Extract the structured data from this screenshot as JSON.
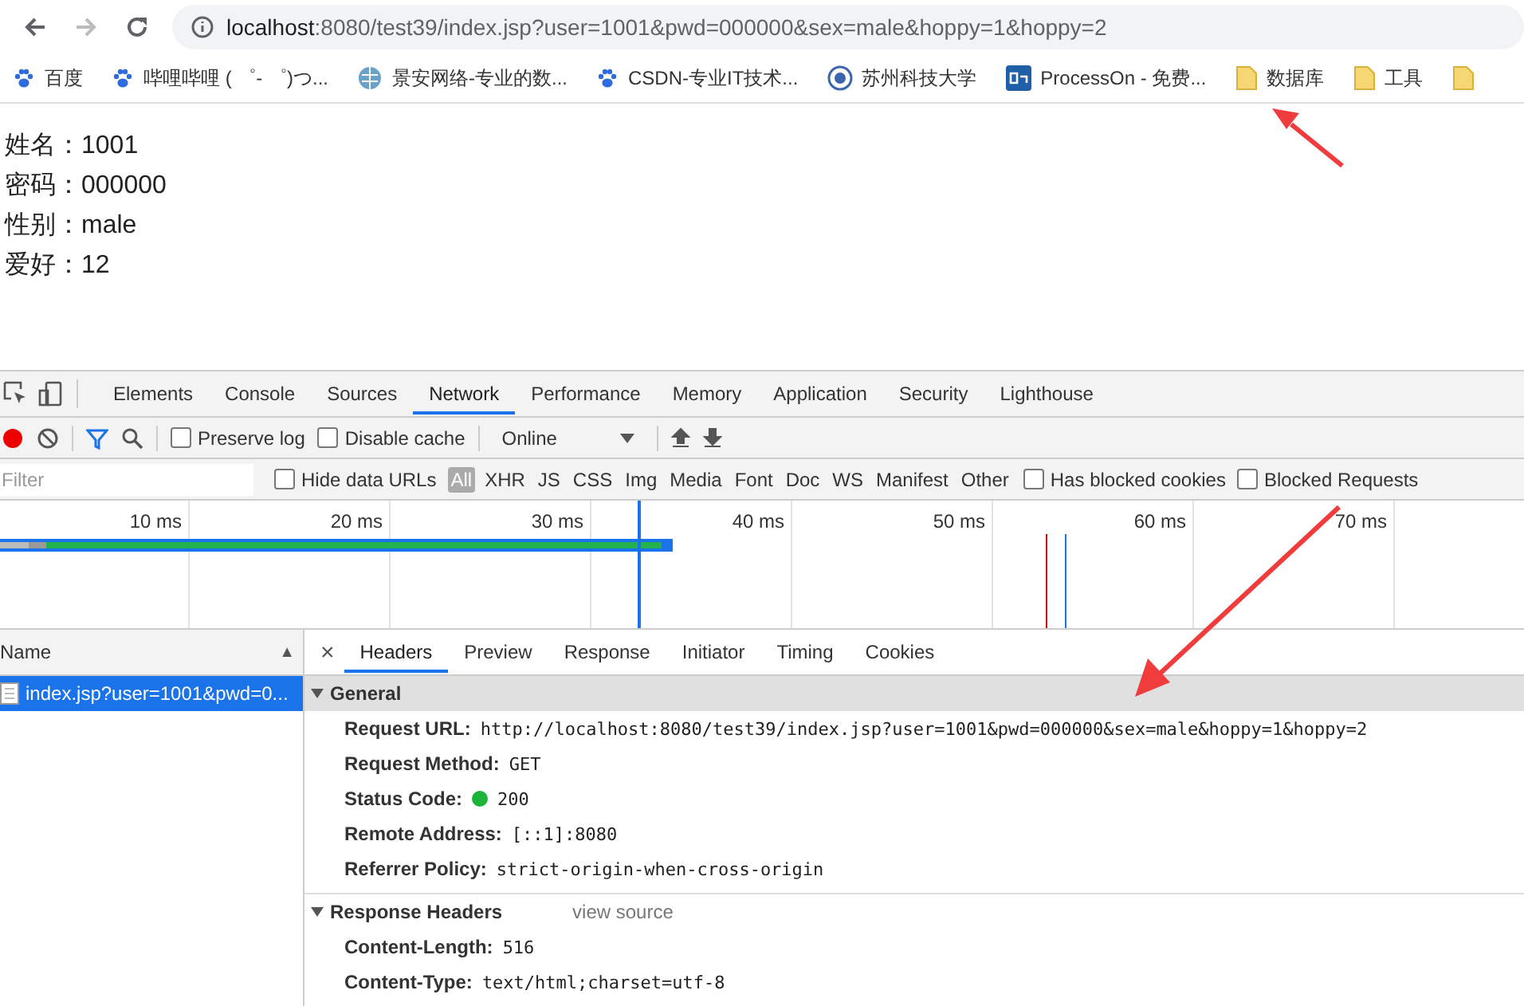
{
  "browser": {
    "url_host": "localhost",
    "url_rest": ":8080/test39/index.jsp?user=1001&pwd=000000&sex=male&hoppy=1&hoppy=2",
    "bookmarks": [
      {
        "label": "百度",
        "kind": "paw"
      },
      {
        "label": "哔哩哔哩 ( ゜- ゜)つ...",
        "kind": "paw"
      },
      {
        "label": "景安网络-专业的数...",
        "kind": "globe"
      },
      {
        "label": "CSDN-专业IT技术...",
        "kind": "paw"
      },
      {
        "label": "苏州科技大学",
        "kind": "seal"
      },
      {
        "label": "ProcessOn - 免费...",
        "kind": "on"
      },
      {
        "label": "数据库",
        "kind": "folder"
      },
      {
        "label": "工具",
        "kind": "folder"
      },
      {
        "kind": "folder"
      }
    ]
  },
  "page": {
    "lines": [
      {
        "label": "姓名：",
        "value": "1001"
      },
      {
        "label": "密码：",
        "value": "000000"
      },
      {
        "label": "性别：",
        "value": "male"
      },
      {
        "label": "爱好：",
        "value": "12"
      }
    ]
  },
  "devtools": {
    "tabs": [
      {
        "label": "Elements",
        "selected": false
      },
      {
        "label": "Console",
        "selected": false
      },
      {
        "label": "Sources",
        "selected": false
      },
      {
        "label": "Network",
        "selected": true
      },
      {
        "label": "Performance",
        "selected": false
      },
      {
        "label": "Memory",
        "selected": false
      },
      {
        "label": "Application",
        "selected": false
      },
      {
        "label": "Security",
        "selected": false
      },
      {
        "label": "Lighthouse",
        "selected": false
      }
    ],
    "toolbar": {
      "recording": true,
      "preserve_log": {
        "label": "Preserve log",
        "checked": false
      },
      "disable_cache": {
        "label": "Disable cache",
        "checked": false
      },
      "throttle": "Online"
    },
    "filter": {
      "placeholder": "Filter",
      "hide_data_urls": {
        "label": "Hide data URLs",
        "checked": false
      },
      "types": [
        {
          "label": "All",
          "selected": true
        },
        {
          "label": "XHR",
          "selected": false
        },
        {
          "label": "JS",
          "selected": false
        },
        {
          "label": "CSS",
          "selected": false
        },
        {
          "label": "Img",
          "selected": false
        },
        {
          "label": "Media",
          "selected": false
        },
        {
          "label": "Font",
          "selected": false
        },
        {
          "label": "Doc",
          "selected": false
        },
        {
          "label": "WS",
          "selected": false
        },
        {
          "label": "Manifest",
          "selected": false
        },
        {
          "label": "Other",
          "selected": false
        }
      ],
      "has_blocked_cookies": {
        "label": "Has blocked cookies",
        "checked": false
      },
      "blocked_requests": {
        "label": "Blocked Requests",
        "checked": false
      }
    },
    "timeline": {
      "ticks": [
        "10 ms",
        "20 ms",
        "30 ms",
        "40 ms",
        "50 ms",
        "60 ms",
        "70 ms"
      ]
    },
    "requests": {
      "column": "Name",
      "sort": "▲",
      "rows": [
        {
          "name": "index.jsp?user=1001&pwd=0...",
          "selected": true
        }
      ]
    },
    "detail": {
      "close": "×",
      "tabs": [
        {
          "label": "Headers",
          "selected": true
        },
        {
          "label": "Preview",
          "selected": false
        },
        {
          "label": "Response",
          "selected": false
        },
        {
          "label": "Initiator",
          "selected": false
        },
        {
          "label": "Timing",
          "selected": false
        },
        {
          "label": "Cookies",
          "selected": false
        }
      ],
      "sections": [
        {
          "title": "General",
          "expanded": true,
          "rows": [
            {
              "label": "Request URL:",
              "value": "http://localhost:8080/test39/index.jsp?user=1001&pwd=000000&sex=male&hoppy=1&hoppy=2",
              "kind": "text"
            },
            {
              "label": "Request Method:",
              "value": "GET",
              "kind": "text"
            },
            {
              "label": "Status Code:",
              "value": "200",
              "kind": "status"
            },
            {
              "label": "Remote Address:",
              "value": "[::1]:8080",
              "kind": "text"
            },
            {
              "label": "Referrer Policy:",
              "value": "strict-origin-when-cross-origin",
              "kind": "text"
            }
          ]
        },
        {
          "title": "Response Headers",
          "link": "view source",
          "expanded": true,
          "rows": [
            {
              "label": "Content-Length:",
              "value": "516",
              "kind": "text"
            },
            {
              "label": "Content-Type:",
              "value": "text/html;charset=utf-8",
              "kind": "text"
            }
          ]
        }
      ]
    }
  }
}
